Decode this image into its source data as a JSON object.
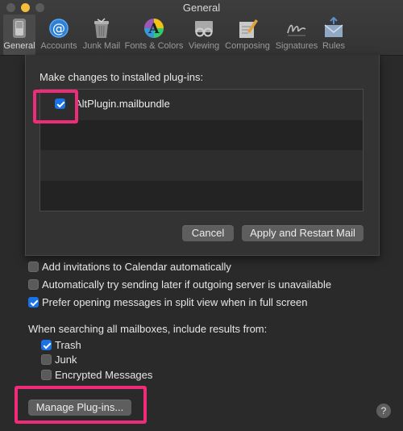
{
  "window": {
    "title": "General"
  },
  "toolbar": {
    "items": [
      {
        "label": "General",
        "icon": "switch-icon",
        "selected": true
      },
      {
        "label": "Accounts",
        "icon": "at-sign-icon"
      },
      {
        "label": "Junk Mail",
        "icon": "trash-can-icon"
      },
      {
        "label": "Fonts & Colors",
        "icon": "font-color-wheel-icon"
      },
      {
        "label": "Viewing",
        "icon": "glasses-icon"
      },
      {
        "label": "Composing",
        "icon": "pencil-paper-icon"
      },
      {
        "label": "Signatures",
        "icon": "signature-icon"
      },
      {
        "label": "Rules",
        "icon": "envelope-rules-icon"
      }
    ]
  },
  "sheet": {
    "heading": "Make changes to installed plug-ins:",
    "plugins": [
      {
        "name": "AltPlugin.mailbundle",
        "checked": true
      }
    ],
    "cancel_label": "Cancel",
    "apply_label": "Apply and Restart Mail"
  },
  "options": {
    "add_invitations": {
      "label": "Add invitations to Calendar automatically",
      "checked": false
    },
    "try_sending_later": {
      "label": "Automatically try sending later if outgoing server is unavailable",
      "checked": false
    },
    "prefer_split_view": {
      "label": "Prefer opening messages in split view when in full screen",
      "checked": true
    }
  },
  "search": {
    "heading": "When searching all mailboxes, include results from:",
    "trash": {
      "label": "Trash",
      "checked": true
    },
    "junk": {
      "label": "Junk",
      "checked": false
    },
    "encrypted": {
      "label": "Encrypted Messages",
      "checked": false
    }
  },
  "manage_plugins_label": "Manage Plug-ins...",
  "help_label": "?",
  "colors": {
    "highlight": "#ee2c7a",
    "checkbox_accent": "#1a72e8",
    "minimize_button": "#f4be3a"
  }
}
